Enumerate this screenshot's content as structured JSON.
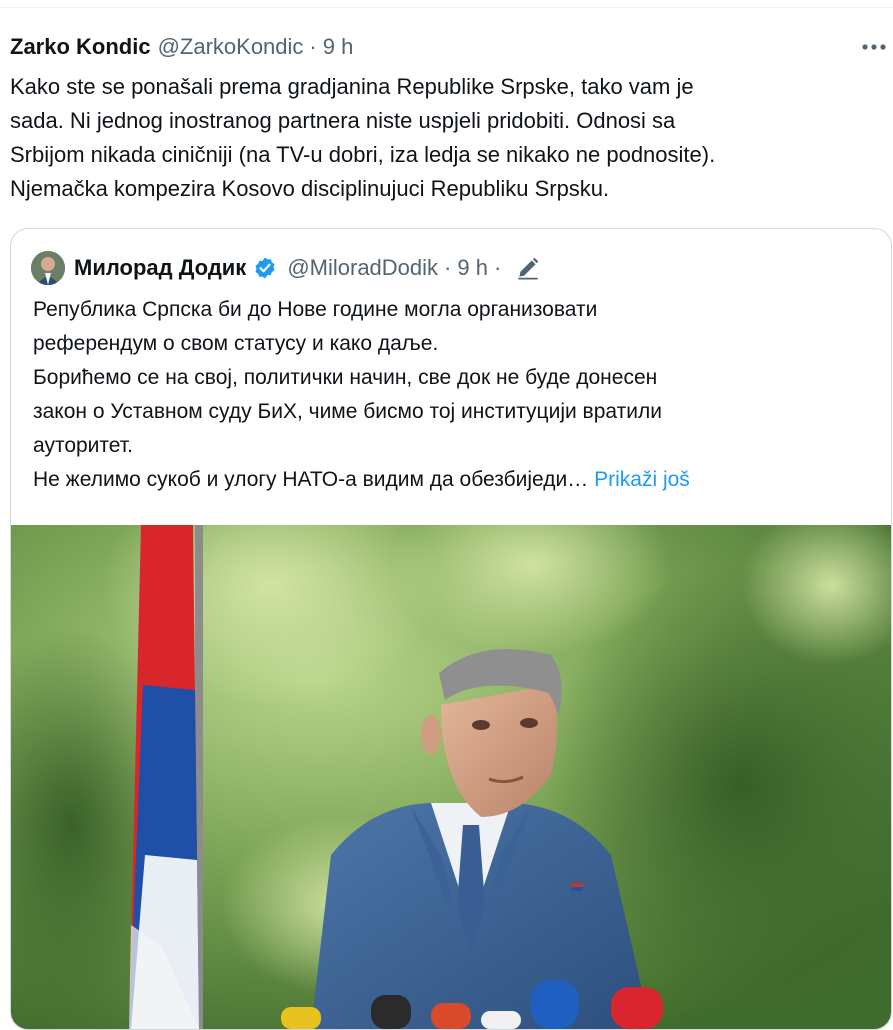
{
  "tweet": {
    "author_name": "Zarko Kondic",
    "author_handle": "@ZarkoKondic",
    "separator": "·",
    "time": "9 h",
    "more_icon": "ellipsis-icon",
    "text_lines": [
      "Kako ste se ponašali prema gradjanina Republike Srpske, tako vam je",
      "sada. Ni jednog inostranog partnera niste uspjeli pridobiti. Odnosi sa",
      "Srbijom nikada ciničniji (na TV-u dobri, iza ledja se nikako ne podnosite).",
      "Njemačka kompezira Kosovo disciplinujuci Republiku Srpsku."
    ]
  },
  "quote": {
    "author_name": "Милорад Додик",
    "author_handle": "@MiloradDodik",
    "separator": "·",
    "time": "9 h",
    "separator2": "·",
    "verified_icon": "verified-badge-icon",
    "edit_icon": "edited-pencil-icon",
    "text_lines": [
      "Република Српска би до Нове године могла организовати",
      "референдум о свом статусу и како даље.",
      "Борићемо се на свој, политички начин, све док не буде донесен",
      "закон о Уставном суду БиХ, чиме бисмо тој институцији вратили",
      "ауторитет.",
      "Не желимо сукоб и улогу НАТО-а видим да обезбиједи…"
    ],
    "show_more": "Prikaži još"
  },
  "colors": {
    "text": "#0f1419",
    "secondary": "#536471",
    "link": "#1d9bf0",
    "border": "#cfd9de"
  }
}
